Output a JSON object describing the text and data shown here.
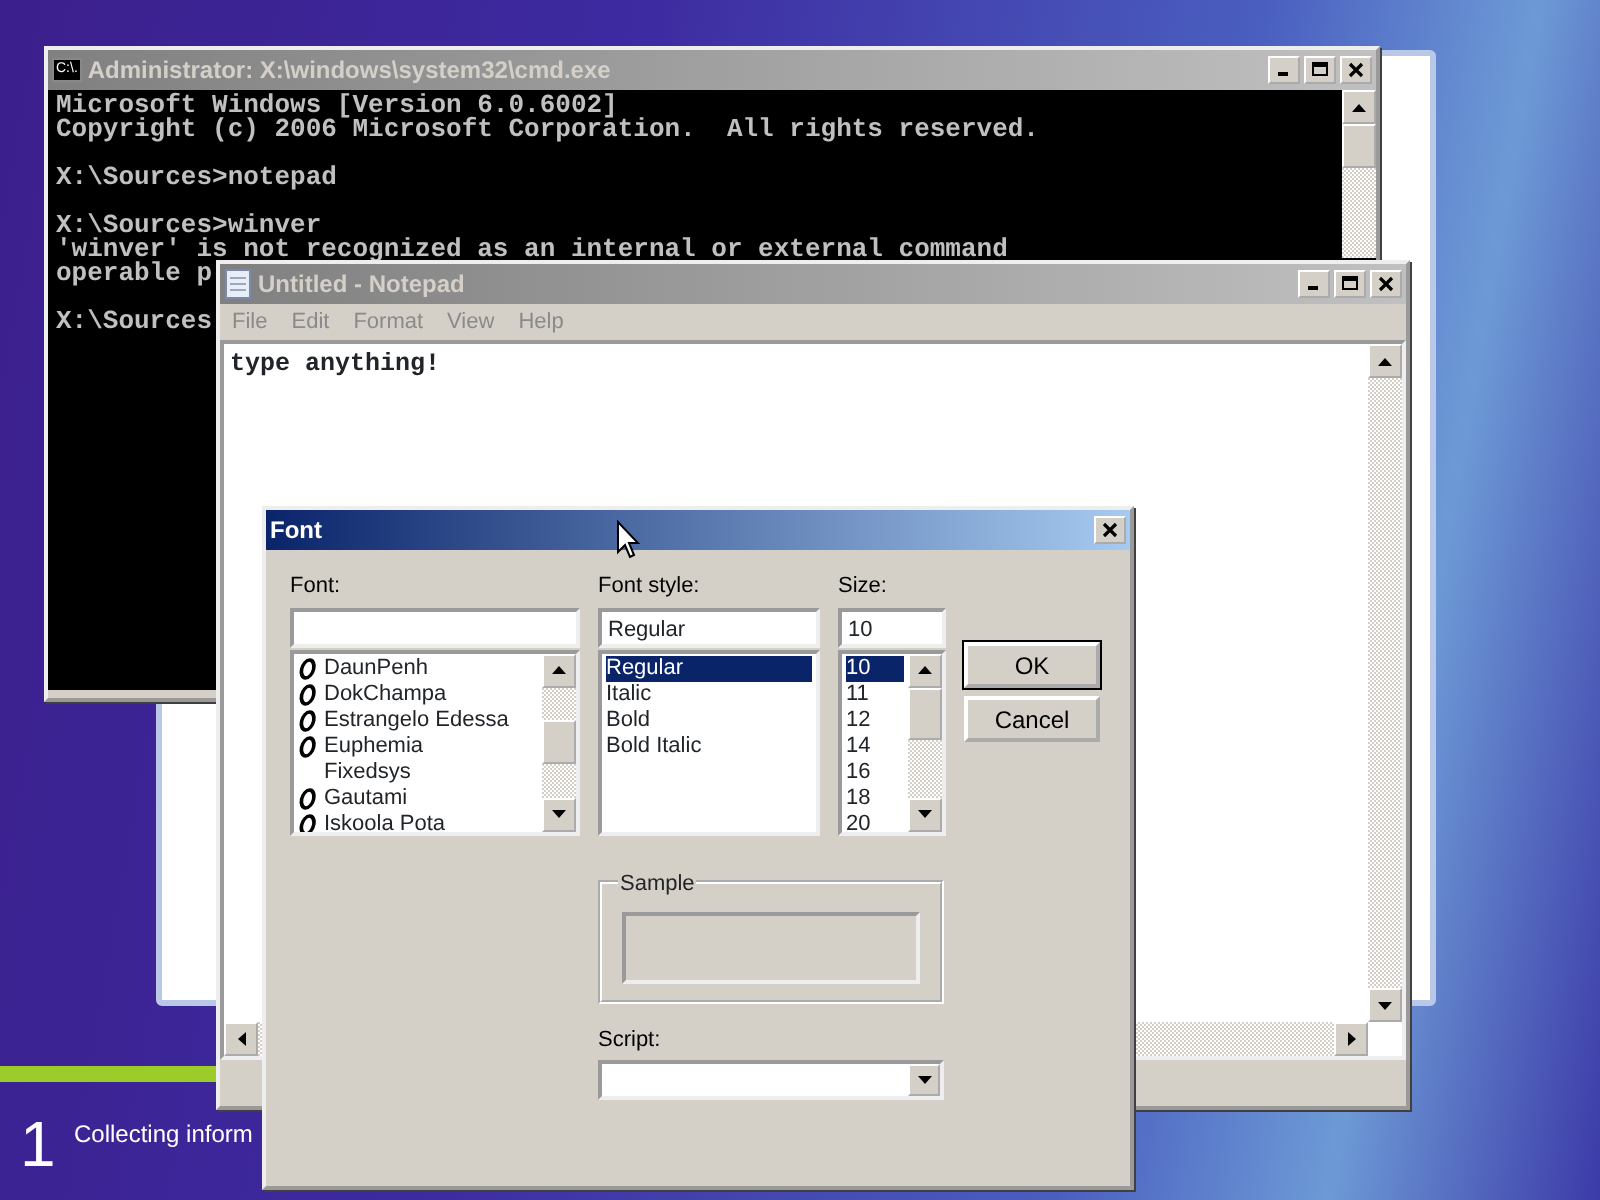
{
  "cmd_window": {
    "title": "Administrator: X:\\windows\\system32\\cmd.exe",
    "icon_text": "C:\\.",
    "blocks": [
      {
        "lines": [
          "Microsoft Windows [Version 6.0.6002]",
          "Copyright (c) 2006 Microsoft Corporation.  All rights reserved."
        ]
      },
      {
        "lines": [
          "X:\\Sources>notepad"
        ]
      },
      {
        "lines": [
          "X:\\Sources>winver",
          "'winver' is not recognized as an internal or external command",
          "operable p"
        ]
      },
      {
        "lines": [
          "X:\\Sources"
        ]
      }
    ]
  },
  "notepad": {
    "title": "Untitled - Notepad",
    "menu": [
      "File",
      "Edit",
      "Format",
      "View",
      "Help"
    ],
    "text": "type anything!"
  },
  "font_dialog": {
    "title": "Font",
    "font_label": "Font:",
    "fonts": [
      {
        "name": "DaunPenh",
        "opentype": true
      },
      {
        "name": "DokChampa",
        "opentype": true
      },
      {
        "name": "Estrangelo Edessa",
        "opentype": true
      },
      {
        "name": "Euphemia",
        "opentype": true
      },
      {
        "name": "Fixedsys",
        "opentype": false
      },
      {
        "name": "Gautami",
        "opentype": true
      },
      {
        "name": "Iskoola Pota",
        "opentype": true
      }
    ],
    "style_label": "Font style:",
    "style_value": "Regular",
    "styles": [
      {
        "label": "Regular",
        "selected": true
      },
      {
        "label": "Italic",
        "selected": false
      },
      {
        "label": "Bold",
        "selected": false
      },
      {
        "label": "Bold Italic",
        "selected": false
      }
    ],
    "size_label": "Size:",
    "size_value": "10",
    "sizes": [
      {
        "label": "10",
        "selected": true
      },
      {
        "label": "11",
        "selected": false
      },
      {
        "label": "12",
        "selected": false
      },
      {
        "label": "14",
        "selected": false
      },
      {
        "label": "16",
        "selected": false
      },
      {
        "label": "18",
        "selected": false
      },
      {
        "label": "20",
        "selected": false
      }
    ],
    "buttons": [
      {
        "label": "OK",
        "default": true
      },
      {
        "label": "Cancel",
        "default": false
      }
    ],
    "sample_label": "Sample",
    "script_label": "Script:"
  },
  "setup": {
    "step": "1",
    "status": "Collecting inform"
  }
}
